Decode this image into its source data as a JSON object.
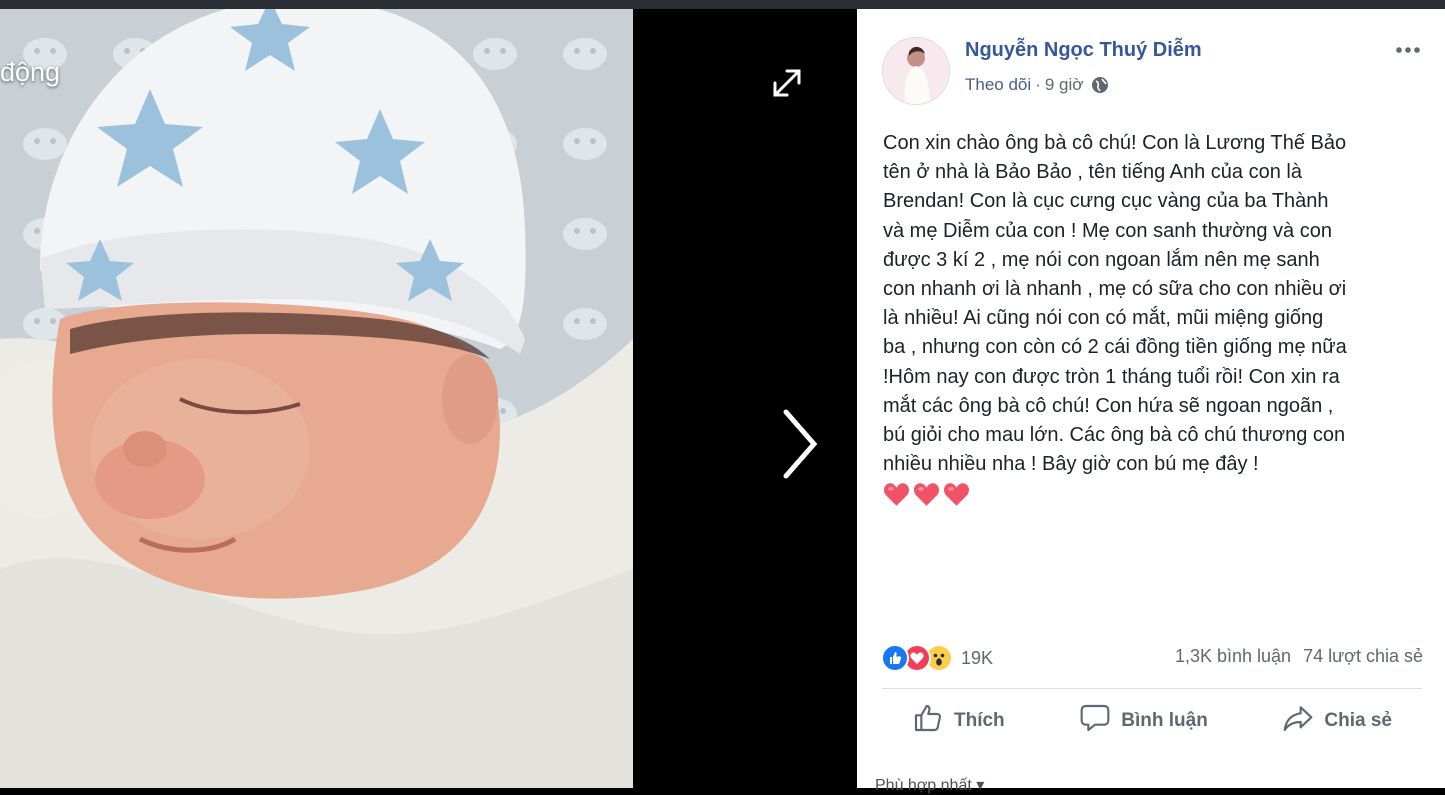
{
  "photo": {
    "title_fragment": "động"
  },
  "post": {
    "author": "Nguyễn Ngọc Thuý Diễm",
    "follow": "Theo dõi",
    "separator": " · ",
    "time": "9 giờ",
    "privacy_icon": "globe-icon",
    "text": "Con xin chào ông bà cô chú! Con là Lương Thế Bảo\ntên ở nhà là Bảo Bảo , tên tiếng Anh của con là\nBrendan! Con là cục cưng cục vàng của ba Thành\nvà mẹ Diễm của con ! Mẹ con sanh thường và con\nđược 3 kí 2 , mẹ nói con ngoan lắm nên mẹ sanh\ncon nhanh ơi là nhanh , mẹ có sữa cho con nhiều ơi\nlà nhiều! Ai cũng nói con có mắt, mũi miệng giống\nba , nhưng con còn có 2 cái đồng tiền giống mẹ nữa\n!Hôm nay con được tròn 1 tháng tuổi rồi! Con xin ra\nmắt các ông bà cô chú! Con hứa sẽ ngoan ngoãn ,\nbú giỏi cho mau lớn. Các ông bà cô chú thương con\nnhiều nhiều nha ! Bây giờ con bú mẹ đây !",
    "emoji": [
      "heart-emoji",
      "heart-emoji",
      "heart-emoji"
    ]
  },
  "engagement": {
    "reaction_icons": [
      "like-reaction-icon",
      "love-reaction-icon",
      "wow-reaction-icon"
    ],
    "reaction_count": "19K",
    "comments": "1,3K bình luận",
    "shares": "74 lượt chia sẻ"
  },
  "actions": {
    "like": "Thích",
    "comment": "Bình luận",
    "share": "Chia sẻ"
  },
  "comments": {
    "sort": "Phù hợp nhất ▾"
  },
  "colors": {
    "link_blue": "#365899",
    "like_blue": "#1877f2",
    "love_red": "#f33e58",
    "wow_yellow": "#fbcd4a"
  }
}
